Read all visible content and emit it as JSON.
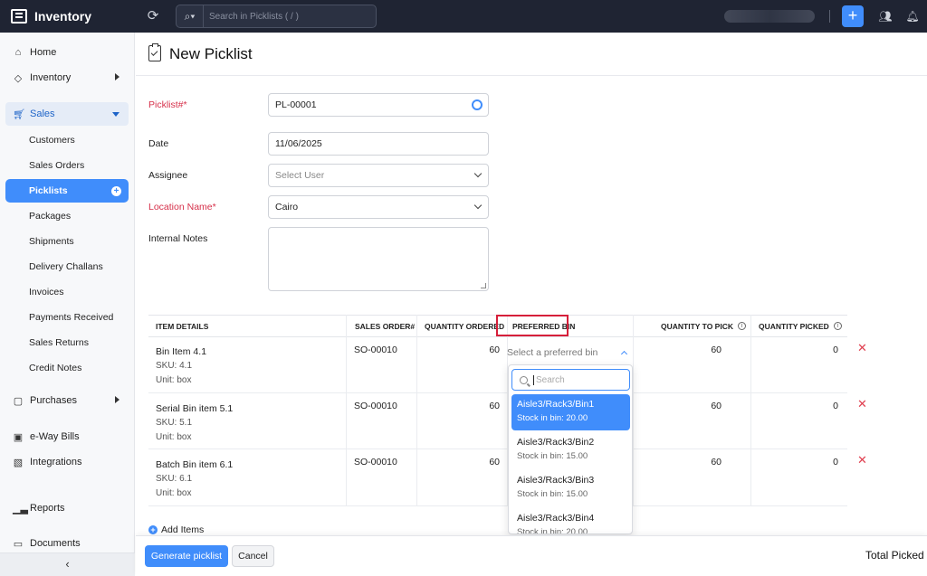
{
  "app": {
    "title": "Inventory"
  },
  "topbar": {
    "search_placeholder": "Search in Picklists ( / )"
  },
  "sidebar": {
    "items": [
      {
        "label": "Home"
      },
      {
        "label": "Inventory"
      },
      {
        "label": "Sales"
      },
      {
        "label": "Purchases"
      },
      {
        "label": "e-Way Bills"
      },
      {
        "label": "Integrations"
      },
      {
        "label": "Reports"
      },
      {
        "label": "Documents"
      }
    ],
    "sales_sub": [
      {
        "label": "Customers"
      },
      {
        "label": "Sales Orders"
      },
      {
        "label": "Picklists"
      },
      {
        "label": "Packages"
      },
      {
        "label": "Shipments"
      },
      {
        "label": "Delivery Challans"
      },
      {
        "label": "Invoices"
      },
      {
        "label": "Payments Received"
      },
      {
        "label": "Sales Returns"
      },
      {
        "label": "Credit Notes"
      }
    ]
  },
  "page": {
    "title": "New Picklist"
  },
  "form": {
    "picklist_label": "Picklist#*",
    "picklist_value": "PL-00001",
    "date_label": "Date",
    "date_value": "11/06/2025",
    "assignee_label": "Assignee",
    "assignee_placeholder": "Select User",
    "location_label": "Location Name*",
    "location_value": "Cairo",
    "notes_label": "Internal Notes"
  },
  "table": {
    "headers": {
      "item_details": "ITEM DETAILS",
      "sales_order": "SALES ORDER#",
      "qty_ordered": "QUANTITY ORDERED",
      "preferred_bin": "PREFERRED BIN",
      "qty_to_pick": "QUANTITY TO PICK",
      "qty_picked": "QUANTITY PICKED"
    },
    "rows": [
      {
        "name": "Bin Item 4.1",
        "sku": "SKU: 4.1",
        "unit": "Unit: box",
        "so": "SO-00010",
        "ordered": "60",
        "to_pick": "60",
        "picked": "0"
      },
      {
        "name": "Serial Bin item 5.1",
        "sku": "SKU: 5.1",
        "unit": "Unit: box",
        "so": "SO-00010",
        "ordered": "60",
        "to_pick": "60",
        "picked": "0"
      },
      {
        "name": "Batch Bin item 6.1",
        "sku": "SKU: 6.1",
        "unit": "Unit: box",
        "so": "SO-00010",
        "ordered": "60",
        "to_pick": "60",
        "picked": "0"
      }
    ],
    "bin_placeholder": "Select a preferred bin",
    "add_items": "Add Items"
  },
  "bin_dropdown": {
    "search_placeholder": "Search",
    "options": [
      {
        "name": "Aisle3/Rack3/Bin1",
        "stock": "Stock in bin: 20.00"
      },
      {
        "name": "Aisle3/Rack3/Bin2",
        "stock": "Stock in bin: 15.00"
      },
      {
        "name": "Aisle3/Rack3/Bin3",
        "stock": "Stock in bin: 15.00"
      },
      {
        "name": "Aisle3/Rack3/Bin4",
        "stock": "Stock in bin: 20.00"
      }
    ]
  },
  "footer": {
    "generate": "Generate picklist",
    "cancel": "Cancel",
    "total_picked": "Total Picked"
  },
  "colors": {
    "accent": "#408dfb",
    "topbar": "#1f2433",
    "required": "#d6304a",
    "highlight": "#d61f3a"
  }
}
